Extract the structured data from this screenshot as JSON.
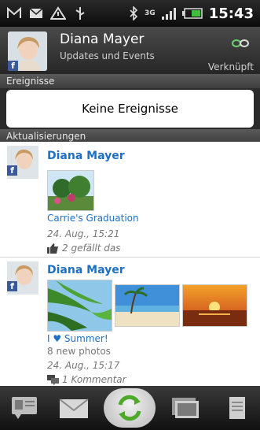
{
  "status_bar": {
    "time": "15:43",
    "network": "3G",
    "icons": [
      "gmail-icon",
      "mail-icon",
      "warning-icon",
      "usb-icon",
      "bluetooth-icon",
      "signal-icon",
      "battery-icon"
    ]
  },
  "header": {
    "name": "Diana Mayer",
    "subtitle": "Updates und Events",
    "linked_label": "Verknüpft",
    "badge": "f"
  },
  "sections": {
    "events_label": "Ereignisse",
    "events_empty": "Keine Ereignisse",
    "updates_label": "Aktualisierungen"
  },
  "updates": [
    {
      "name": "Diana Mayer",
      "album": "Carrie's Graduation",
      "time": "24. Aug., 15:21",
      "likes": "2 gefällt das"
    },
    {
      "name": "Diana Mayer",
      "album": "I ♥ Summer!",
      "photo_count": "8 new photos",
      "time": "24. Aug., 15:17",
      "comments": "1 Kommentar"
    }
  ],
  "bottom_tabs": [
    "profile-tab",
    "message-tab",
    "updates-tab",
    "gallery-tab",
    "more-tab"
  ],
  "colors": {
    "accent": "#1e6fc6",
    "facebook": "#3b5998"
  }
}
